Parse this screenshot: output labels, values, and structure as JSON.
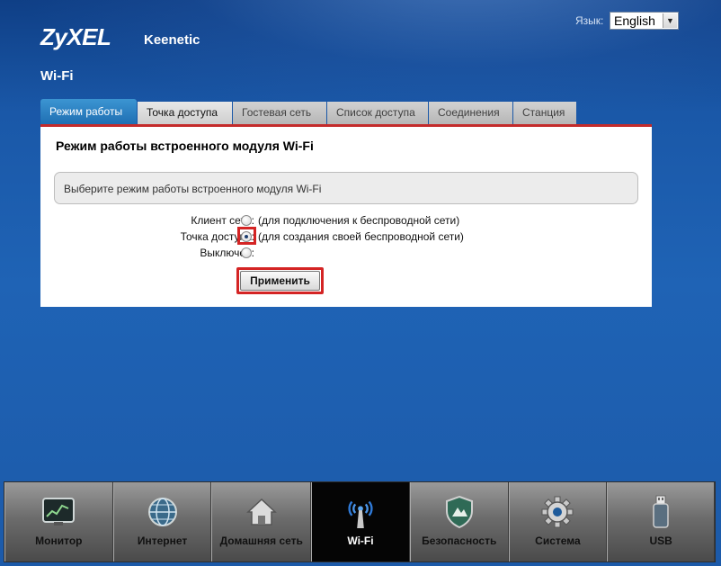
{
  "header": {
    "logo": "ZyXEL",
    "product": "Keenetic",
    "language_label": "Язык:",
    "language_value": "English"
  },
  "page": {
    "title": "Wi-Fi"
  },
  "tabs": [
    {
      "label": "Режим работы",
      "active": true
    },
    {
      "label": "Точка доступа"
    },
    {
      "label": "Гостевая сеть"
    },
    {
      "label": "Список доступа"
    },
    {
      "label": "Соединения"
    },
    {
      "label": "Станция"
    }
  ],
  "panel": {
    "title": "Режим работы встроенного модуля Wi-Fi",
    "info": "Выберите режим работы встроенного модуля Wi-Fi",
    "options": [
      {
        "label": "Клиент сети:",
        "desc": "(для подключения к беспроводной сети)",
        "checked": false
      },
      {
        "label": "Точка доступа:",
        "desc": "(для создания своей беспроводной сети)",
        "checked": true
      },
      {
        "label": "Выключен:",
        "desc": "",
        "checked": false
      }
    ],
    "apply_label": "Применить"
  },
  "nav": [
    {
      "label": "Монитор",
      "icon": "monitor-icon"
    },
    {
      "label": "Интернет",
      "icon": "globe-icon"
    },
    {
      "label": "Домашняя сеть",
      "icon": "home-icon"
    },
    {
      "label": "Wi-Fi",
      "icon": "wifi-antenna-icon",
      "active": true
    },
    {
      "label": "Безопасность",
      "icon": "shield-icon"
    },
    {
      "label": "Система",
      "icon": "gear-icon"
    },
    {
      "label": "USB",
      "icon": "usb-drive-icon"
    }
  ],
  "colors": {
    "background": "#1f63b5",
    "tab_active": "#2a80c2",
    "panel_accent": "#c42b2b",
    "highlight": "#d42424"
  }
}
